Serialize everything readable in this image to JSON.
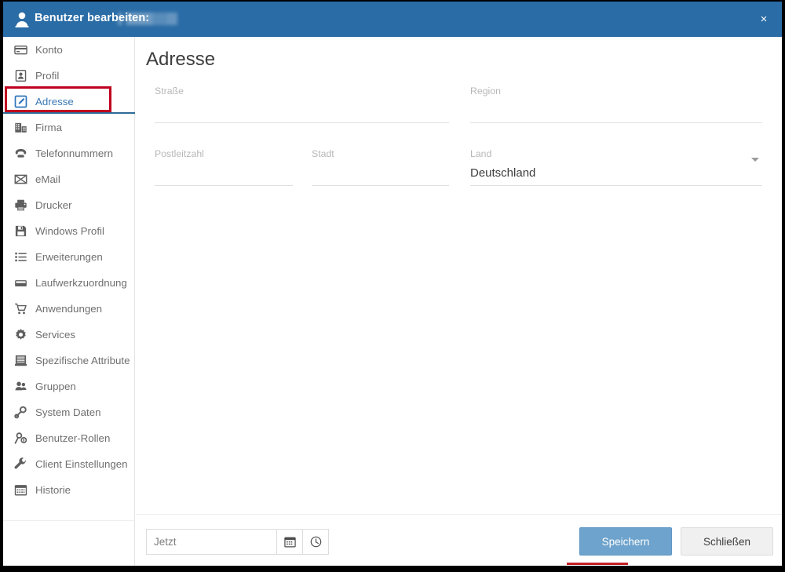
{
  "titlebar": {
    "icon": "user-icon",
    "title": "Benutzer bearbeiten:",
    "redacted_value": "",
    "close_label": "×",
    "background_color": "#2a6ca6"
  },
  "sidebar": {
    "items": [
      {
        "label": "Konto",
        "icon": "credit-card-icon",
        "active": false
      },
      {
        "label": "Profil",
        "icon": "id-card-icon",
        "active": false
      },
      {
        "label": "Adresse",
        "icon": "edit-square-icon",
        "active": true
      },
      {
        "label": "Firma",
        "icon": "building-icon",
        "active": false
      },
      {
        "label": "Telefonnummern",
        "icon": "telephone-icon",
        "active": false
      },
      {
        "label": "eMail",
        "icon": "envelope-icon",
        "active": false
      },
      {
        "label": "Drucker",
        "icon": "printer-icon",
        "active": false
      },
      {
        "label": "Windows Profil",
        "icon": "floppy-disk-icon",
        "active": false
      },
      {
        "label": "Erweiterungen",
        "icon": "list-icon",
        "active": false
      },
      {
        "label": "Laufwerkzuordnung",
        "icon": "drive-icon",
        "active": false
      },
      {
        "label": "Anwendungen",
        "icon": "shopping-cart-icon",
        "active": false
      },
      {
        "label": "Services",
        "icon": "gear-icon",
        "active": false
      },
      {
        "label": "Spezifische Attribute",
        "icon": "archive-icon",
        "active": false
      },
      {
        "label": "Gruppen",
        "icon": "users-icon",
        "active": false
      },
      {
        "label": "System Daten",
        "icon": "key-icon",
        "active": false
      },
      {
        "label": "Benutzer-Rollen",
        "icon": "user-key-icon",
        "active": false
      },
      {
        "label": "Client Einstellungen",
        "icon": "wrench-icon",
        "active": false
      },
      {
        "label": "Historie",
        "icon": "calendar-icon",
        "active": false
      }
    ]
  },
  "main": {
    "page_title": "Adresse",
    "fields": {
      "strasse": {
        "label": "Straße",
        "value": "",
        "placeholder": ""
      },
      "region": {
        "label": "Region",
        "value": "",
        "placeholder": ""
      },
      "postleitzahl": {
        "label": "Postleitzahl",
        "value": "",
        "placeholder": ""
      },
      "stadt": {
        "label": "Stadt",
        "value": "",
        "placeholder": ""
      },
      "land": {
        "label": "Land",
        "value": "Deutschland"
      }
    }
  },
  "footer": {
    "datetime_placeholder": "Jetzt",
    "datetime_value": "",
    "calendar_icon": "calendar-icon",
    "clock_icon": "clock-icon",
    "save_label": "Speichern",
    "close_label": "Schließen",
    "save_color": "#6da3cc"
  },
  "annotations": {
    "highlight_color": "#c00020",
    "underline_color": "#c22225"
  }
}
